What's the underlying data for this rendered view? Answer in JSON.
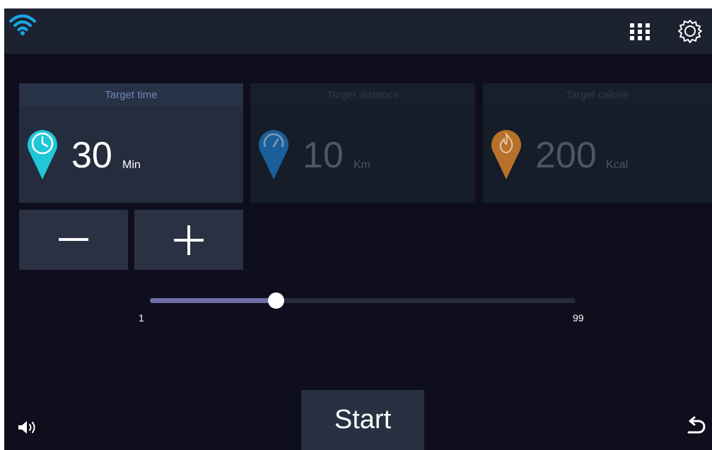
{
  "topbar": {
    "wifi_icon": "wifi-icon",
    "apps_icon": "grid-icon",
    "settings_icon": "gear-icon"
  },
  "targets": [
    {
      "id": "time",
      "label": "Target time",
      "value": "30",
      "unit": "Min",
      "icon": "clock-pin-icon",
      "color": "#20c7d6",
      "active": true
    },
    {
      "id": "distance",
      "label": "Target distance",
      "value": "10",
      "unit": "Km",
      "icon": "speedometer-pin-icon",
      "color": "#1b5f9a",
      "active": false
    },
    {
      "id": "calorie",
      "label": "Target calorie",
      "value": "200",
      "unit": "Kcal",
      "icon": "flame-pin-icon",
      "color": "#b8702a",
      "active": false
    }
  ],
  "stepper": {
    "minus_icon": "minus-icon",
    "plus_icon": "plus-icon"
  },
  "slider": {
    "min_label": "1",
    "max_label": "99",
    "min": 1,
    "max": 99,
    "value": 30
  },
  "start": {
    "label": "Start"
  },
  "footer": {
    "volume_icon": "volume-icon",
    "back_icon": "back-arrow-icon"
  },
  "colors": {
    "background": "#0e0e1d",
    "topbar": "#1d2231",
    "accent": "#6d6fa6"
  }
}
